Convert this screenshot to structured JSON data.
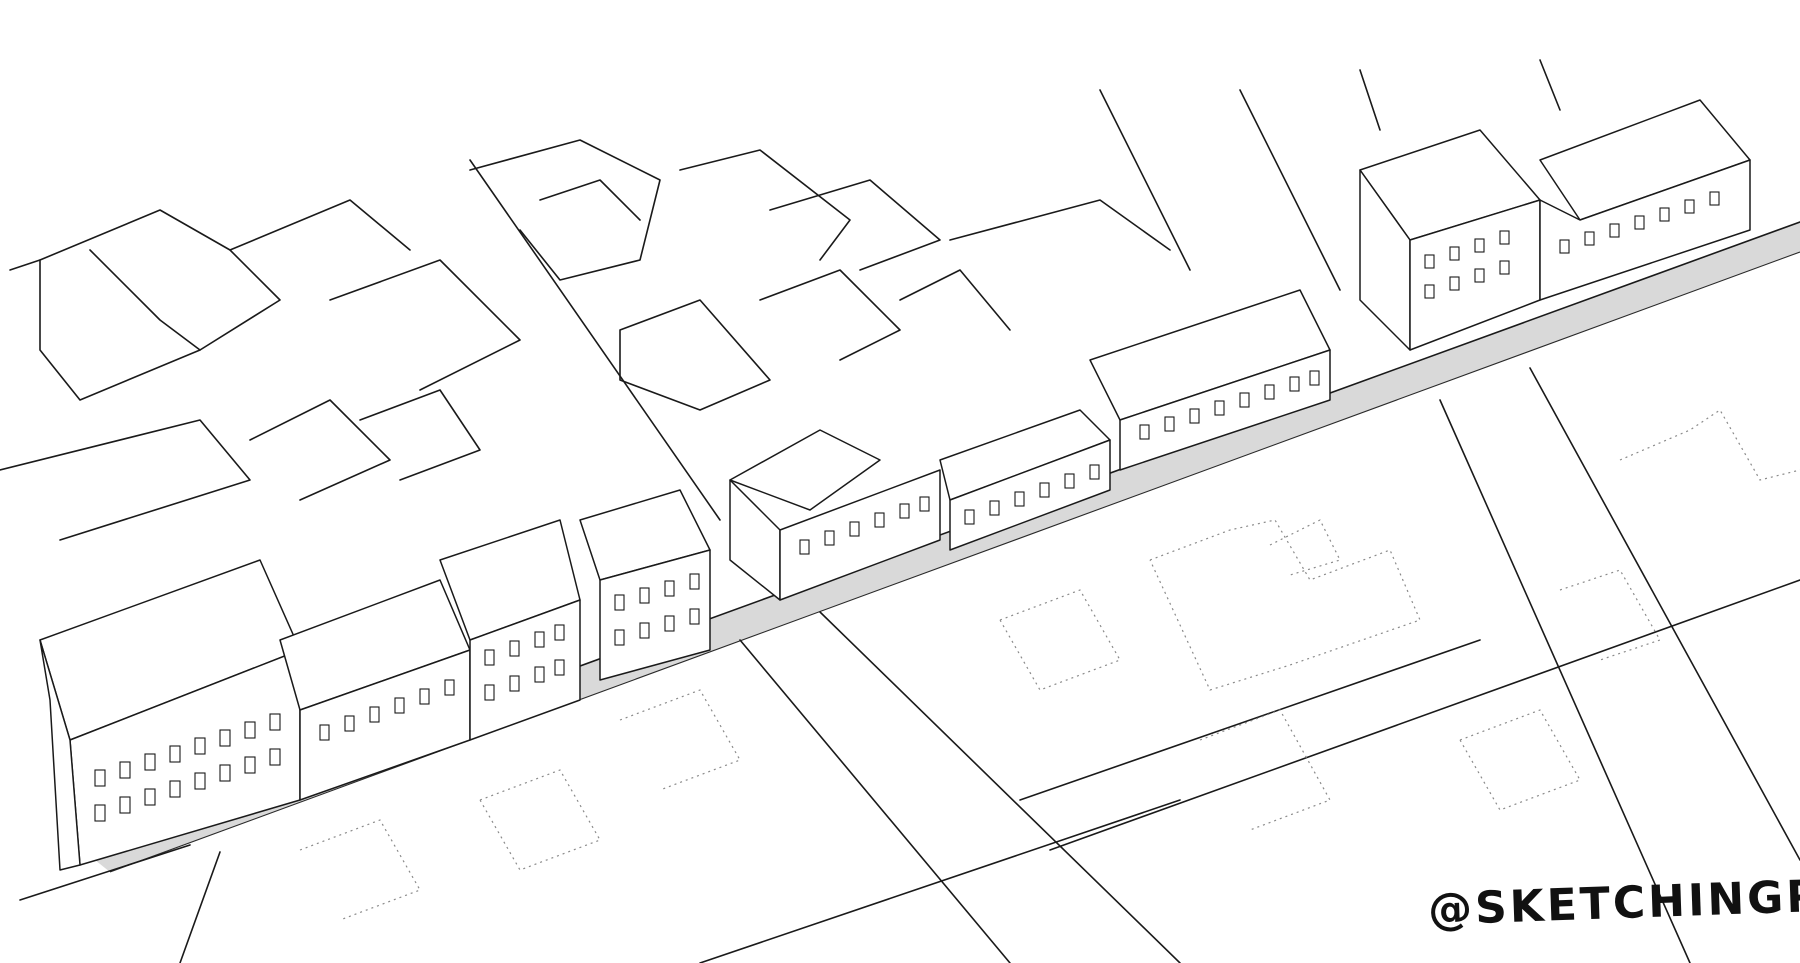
{
  "artwork": {
    "style": "black ink line drawing, isometric city street",
    "colors": {
      "background": "#ffffff",
      "ink": "#1a1a1a",
      "sidewalk": "#d9d9d9",
      "dotted_lines": "#8a8a8a"
    }
  },
  "signature": {
    "text": "@SKETCHINGPAAS"
  }
}
